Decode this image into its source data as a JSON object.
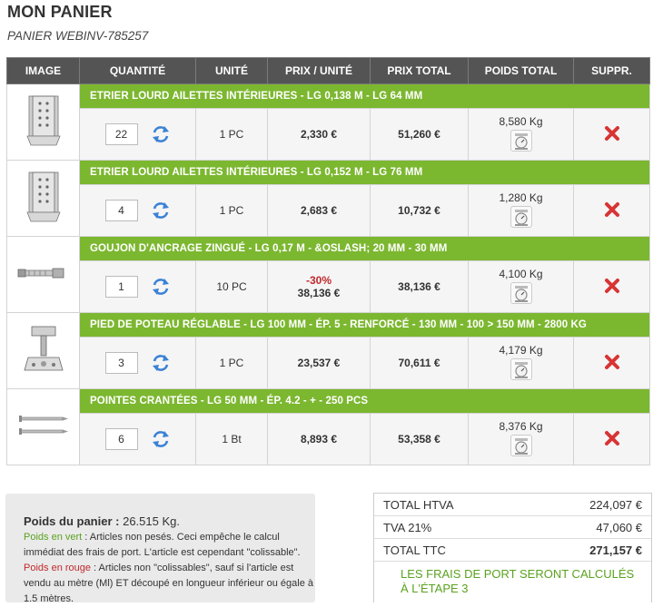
{
  "page": {
    "title": "MON PANIER",
    "subtitle": "PANIER WEBINV-785257"
  },
  "table": {
    "headers": [
      "IMAGE",
      "QUANTITÉ",
      "UNITÉ",
      "PRIX / UNITÉ",
      "PRIX TOTAL",
      "POIDS TOTAL",
      "SUPPR."
    ],
    "items": [
      {
        "name": "ETRIER LOURD AILETTES INTÉRIEURES - LG 0,138 M - LG 64 MM",
        "qty": "22",
        "unit": "1 PC",
        "discount": "",
        "unit_price": "2,330 €",
        "total": "51,260 €",
        "weight": "8,580 Kg",
        "image": "bracket-image"
      },
      {
        "name": "ETRIER LOURD AILETTES INTÉRIEURES - LG 0,152 M - LG 76 MM",
        "qty": "4",
        "unit": "1 PC",
        "discount": "",
        "unit_price": "2,683 €",
        "total": "10,732 €",
        "weight": "1,280 Kg",
        "image": "bracket-image"
      },
      {
        "name": "GOUJON D'ANCRAGE ZINGUÉ - LG 0,17 M - &OSLASH; 20 MM - 30 MM",
        "qty": "1",
        "unit": "10 PC",
        "discount": "-30%",
        "unit_price": "38,136 €",
        "total": "38,136 €",
        "weight": "4,100 Kg",
        "image": "anchor-bolt-image"
      },
      {
        "name": "PIED DE POTEAU RÉGLABLE - LG 100 MM - ÉP. 5 - RENFORCÉ - 130 MM - 100 > 150 MM - 2800 KG",
        "qty": "3",
        "unit": "1 PC",
        "discount": "",
        "unit_price": "23,537 €",
        "total": "70,611 €",
        "weight": "4,179 Kg",
        "image": "post-base-image"
      },
      {
        "name": "POINTES CRANTÉES - LG 50 MM - ÉP. 4.2 - + - 250 PCS",
        "qty": "6",
        "unit": "1 Bt",
        "discount": "",
        "unit_price": "8,893 €",
        "total": "53,358 €",
        "weight": "8,376 Kg",
        "image": "nails-image"
      }
    ]
  },
  "summary": {
    "weight_label": "Poids du panier :",
    "weight_value": "26.515 Kg.",
    "green_label": "Poids en vert",
    "green_text": " : Articles non pesés. Ceci empêche le calcul immédiat des frais de port. L'article est cependant \"colissable\".",
    "red_label": "Poids en rouge",
    "red_text": " : Articles non \"colissables\", sauf si l'article est vendu au mètre (Ml) ET découpé en longueur inférieur ou égale à 1.5 mètres."
  },
  "totals": {
    "htva_label": "TOTAL HTVA",
    "htva_value": "224,097 €",
    "tva_label": "TVA 21%",
    "tva_value": "47,060 €",
    "ttc_label": "TOTAL TTC",
    "ttc_value": "271,157 €",
    "shipping_note": "LES FRAIS DE PORT SERONT CALCULÉS À L'ÉTAPE 3"
  },
  "colors": {
    "header_bg": "#545454",
    "product_bar": "#7cb730",
    "discount": "#c0282d",
    "note_green": "#5aa21f"
  },
  "icons": {
    "refresh": "refresh-icon",
    "scale": "scale-icon",
    "delete": "delete-icon"
  }
}
